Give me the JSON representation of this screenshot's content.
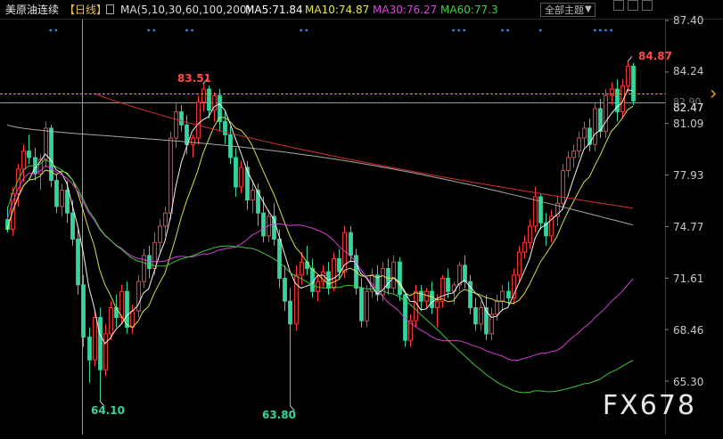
{
  "header": {
    "symbol": "美原油连续",
    "period": "【日线】",
    "ma_params": "MA(5,10,30,60,100,200)",
    "ma5": "MA5:71.84",
    "ma10": "MA10:74.87",
    "ma30": "MA30:76.27",
    "ma60": "MA60:77.3",
    "theme_selector": "全部主题"
  },
  "colors": {
    "up": "#ff3b3b",
    "down": "#35d4a0",
    "ma5": "#ffffff",
    "ma10": "#e8e84a",
    "ma30": "#e040e0",
    "ma60": "#40d040",
    "ma100": "#b0b0b0",
    "ma200": "#e03030",
    "axis_text": "#c8c8c8"
  },
  "watermark": "FX678",
  "annotations": {
    "high_label": "84.87",
    "peak_label": "83.51",
    "low1_label": "64.10",
    "low2_label": "63.80",
    "current_price_label": "82.47",
    "hidden_label": "82.90"
  },
  "chart_data": {
    "type": "candlestick",
    "title": "美原油连续【日线】",
    "y_ticks": [
      "87.40",
      "84.24",
      "81.09",
      "77.93",
      "74.77",
      "71.61",
      "68.46",
      "65.30"
    ],
    "ylim": [
      63.0,
      87.8
    ],
    "legend": [
      "MA5",
      "MA10",
      "MA30",
      "MA60"
    ],
    "legend_values": [
      "71.84",
      "74.87",
      "76.27",
      "77.3"
    ],
    "candles": [
      [
        75.2,
        76.0,
        74.4,
        74.6
      ],
      [
        74.6,
        77.2,
        74.2,
        76.8
      ],
      [
        76.8,
        78.6,
        76.0,
        78.3
      ],
      [
        78.3,
        79.8,
        77.5,
        79.4
      ],
      [
        79.4,
        80.4,
        78.6,
        79.0
      ],
      [
        79.0,
        79.6,
        77.6,
        78.0
      ],
      [
        78.0,
        79.2,
        77.0,
        78.9
      ],
      [
        78.9,
        81.2,
        78.4,
        80.8
      ],
      [
        80.8,
        81.0,
        77.2,
        77.6
      ],
      [
        77.6,
        78.0,
        75.6,
        76.0
      ],
      [
        76.0,
        77.4,
        75.4,
        77.0
      ],
      [
        77.0,
        77.6,
        75.0,
        75.6
      ],
      [
        75.6,
        76.4,
        73.6,
        74.0
      ],
      [
        74.0,
        74.6,
        70.6,
        71.2
      ],
      [
        71.2,
        71.8,
        67.4,
        68.0
      ],
      [
        68.0,
        68.6,
        65.2,
        66.6
      ],
      [
        66.6,
        69.6,
        66.2,
        69.2
      ],
      [
        69.2,
        69.8,
        64.1,
        66.0
      ],
      [
        66.0,
        68.8,
        65.6,
        68.2
      ],
      [
        68.2,
        70.2,
        67.8,
        69.8
      ],
      [
        69.8,
        70.6,
        68.6,
        69.2
      ],
      [
        69.2,
        71.2,
        68.8,
        70.8
      ],
      [
        70.8,
        71.4,
        68.2,
        68.6
      ],
      [
        68.6,
        70.0,
        68.2,
        69.6
      ],
      [
        69.6,
        71.8,
        69.2,
        71.4
      ],
      [
        71.4,
        73.4,
        71.0,
        73.0
      ],
      [
        73.0,
        73.6,
        71.6,
        72.2
      ],
      [
        72.2,
        74.4,
        71.8,
        73.8
      ],
      [
        73.8,
        75.2,
        73.2,
        74.8
      ],
      [
        74.8,
        76.0,
        74.2,
        75.6
      ],
      [
        75.6,
        80.6,
        75.2,
        80.2
      ],
      [
        80.2,
        82.4,
        79.6,
        81.8
      ],
      [
        81.8,
        82.2,
        80.6,
        81.0
      ],
      [
        81.0,
        81.6,
        79.2,
        79.8
      ],
      [
        79.8,
        80.4,
        79.0,
        80.2
      ],
      [
        80.2,
        82.8,
        79.8,
        82.4
      ],
      [
        82.4,
        83.51,
        81.8,
        83.2
      ],
      [
        83.2,
        83.4,
        81.4,
        81.9
      ],
      [
        81.9,
        83.0,
        81.2,
        82.8
      ],
      [
        82.8,
        83.2,
        80.6,
        81.2
      ],
      [
        81.2,
        81.8,
        79.8,
        80.4
      ],
      [
        80.4,
        80.9,
        78.6,
        79.0
      ],
      [
        79.0,
        79.6,
        76.6,
        77.2
      ],
      [
        77.2,
        78.8,
        76.8,
        78.4
      ],
      [
        78.4,
        78.8,
        75.8,
        76.4
      ],
      [
        76.4,
        77.6,
        75.6,
        77.0
      ],
      [
        77.0,
        77.4,
        74.8,
        75.6
      ],
      [
        75.6,
        76.6,
        73.8,
        74.2
      ],
      [
        74.2,
        75.8,
        73.8,
        75.4
      ],
      [
        75.4,
        76.2,
        73.6,
        74.0
      ],
      [
        74.0,
        74.6,
        71.0,
        71.6
      ],
      [
        71.6,
        72.4,
        69.6,
        70.2
      ],
      [
        70.2,
        71.0,
        63.8,
        68.8
      ],
      [
        68.8,
        72.4,
        68.4,
        71.8
      ],
      [
        71.8,
        73.2,
        71.2,
        72.6
      ],
      [
        72.6,
        73.6,
        71.8,
        72.2
      ],
      [
        72.2,
        72.8,
        70.4,
        70.8
      ],
      [
        70.8,
        71.8,
        70.2,
        71.4
      ],
      [
        71.4,
        72.4,
        71.0,
        72.0
      ],
      [
        72.0,
        72.6,
        70.6,
        71.0
      ],
      [
        71.0,
        73.2,
        70.8,
        72.8
      ],
      [
        72.8,
        73.4,
        71.6,
        72.0
      ],
      [
        72.0,
        74.8,
        71.6,
        74.4
      ],
      [
        74.4,
        74.8,
        72.6,
        73.0
      ],
      [
        73.0,
        73.4,
        70.6,
        71.0
      ],
      [
        71.0,
        71.6,
        68.6,
        69.0
      ],
      [
        69.0,
        71.2,
        68.6,
        70.8
      ],
      [
        70.8,
        72.2,
        70.4,
        71.8
      ],
      [
        71.8,
        72.4,
        70.2,
        70.6
      ],
      [
        70.6,
        72.6,
        70.2,
        72.2
      ],
      [
        72.2,
        72.8,
        70.6,
        71.0
      ],
      [
        71.0,
        73.0,
        70.6,
        72.6
      ],
      [
        72.6,
        72.9,
        70.2,
        70.6
      ],
      [
        70.6,
        70.8,
        67.4,
        67.8
      ],
      [
        67.8,
        69.4,
        67.4,
        69.0
      ],
      [
        69.0,
        71.2,
        68.6,
        70.8
      ],
      [
        70.8,
        71.2,
        69.6,
        70.2
      ],
      [
        70.2,
        71.0,
        69.8,
        70.8
      ],
      [
        70.8,
        71.4,
        69.4,
        69.8
      ],
      [
        69.8,
        70.6,
        68.6,
        70.2
      ],
      [
        70.2,
        71.8,
        69.8,
        71.6
      ],
      [
        71.6,
        72.2,
        70.4,
        70.8
      ],
      [
        70.8,
        71.4,
        70.0,
        71.2
      ],
      [
        71.2,
        72.6,
        70.8,
        72.4
      ],
      [
        72.4,
        73.0,
        71.0,
        71.4
      ],
      [
        71.4,
        71.8,
        69.4,
        69.8
      ],
      [
        69.8,
        70.4,
        68.4,
        68.8
      ],
      [
        68.8,
        70.2,
        68.4,
        69.8
      ],
      [
        69.8,
        70.6,
        67.8,
        68.2
      ],
      [
        68.2,
        69.8,
        67.8,
        69.4
      ],
      [
        69.4,
        70.6,
        69.0,
        70.2
      ],
      [
        70.2,
        71.2,
        69.6,
        70.8
      ],
      [
        70.8,
        71.4,
        70.0,
        70.4
      ],
      [
        70.4,
        72.2,
        70.0,
        71.8
      ],
      [
        71.8,
        73.6,
        71.4,
        73.2
      ],
      [
        73.2,
        74.2,
        72.8,
        73.8
      ],
      [
        73.8,
        75.2,
        73.4,
        74.8
      ],
      [
        74.8,
        77.2,
        74.4,
        76.6
      ],
      [
        76.6,
        76.8,
        74.6,
        75.0
      ],
      [
        75.0,
        75.6,
        73.6,
        74.2
      ],
      [
        74.2,
        75.8,
        73.8,
        75.4
      ],
      [
        75.4,
        76.6,
        74.8,
        76.2
      ],
      [
        76.2,
        78.6,
        75.8,
        78.2
      ],
      [
        78.2,
        79.4,
        77.8,
        79.0
      ],
      [
        79.0,
        79.8,
        78.4,
        79.4
      ],
      [
        79.4,
        80.6,
        79.0,
        80.2
      ],
      [
        80.2,
        81.2,
        79.6,
        80.8
      ],
      [
        80.8,
        81.4,
        79.4,
        79.8
      ],
      [
        79.8,
        82.4,
        79.4,
        82.0
      ],
      [
        82.0,
        82.6,
        80.2,
        80.6
      ],
      [
        80.6,
        83.2,
        80.2,
        82.8
      ],
      [
        82.8,
        83.6,
        82.2,
        83.2
      ],
      [
        83.2,
        83.8,
        81.2,
        81.8
      ],
      [
        81.8,
        83.8,
        81.4,
        83.4
      ],
      [
        83.4,
        84.87,
        83.0,
        84.6
      ],
      [
        84.6,
        84.8,
        82.2,
        82.47
      ]
    ],
    "current_price": 82.47,
    "high": 84.87,
    "peak": 83.51,
    "lows": [
      64.1,
      63.8
    ]
  }
}
